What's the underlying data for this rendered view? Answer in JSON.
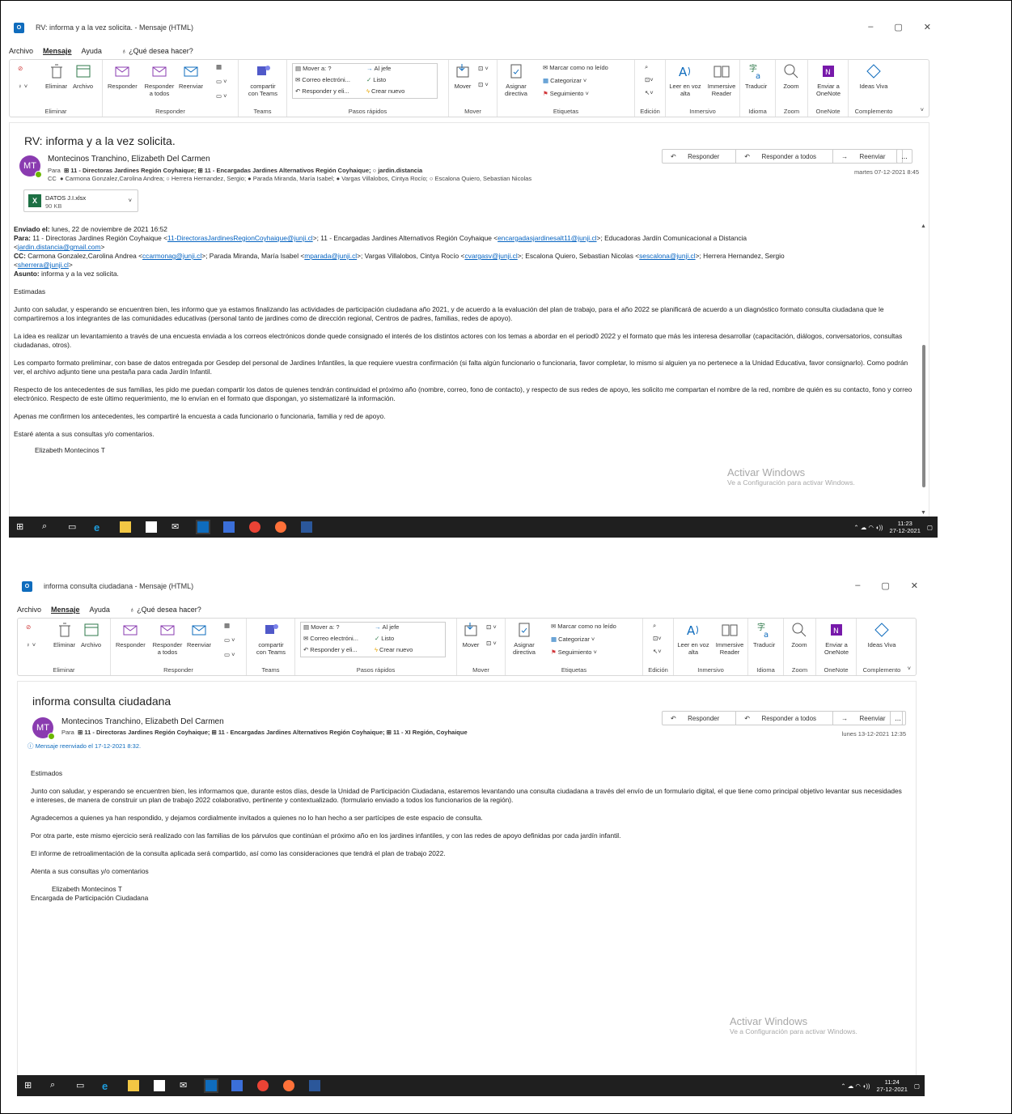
{
  "ribbon": {
    "menu": [
      "Archivo",
      "Mensaje",
      "Ayuda"
    ],
    "tell_me": "¿Qué desea hacer?",
    "eliminar": "Eliminar",
    "archivo": "Archivo",
    "group_eliminar": "Eliminar",
    "responder": "Responder",
    "responder_todos": "Responder a todos",
    "reenviar": "Reenviar",
    "group_responder": "Responder",
    "compartir_teams": "compartir con Teams",
    "group_teams": "Teams",
    "qs_mover": "Mover a: ?",
    "qs_correo": "Correo electróni...",
    "qs_responder": "Responder y eli...",
    "qs_jefe": "Al jefe",
    "qs_listo": "Listo",
    "qs_crear": "Crear nuevo",
    "group_pasos": "Pasos rápidos",
    "mover": "Mover",
    "group_mover": "Mover",
    "asignar": "Asignar directiva",
    "marcar": "Marcar como no leído",
    "categorizar": "Categorizar",
    "seguimiento": "Seguimiento",
    "group_etiquetas": "Etiquetas",
    "group_edicion": "Edición",
    "leer": "Leer en voz alta",
    "immersive": "Immersive Reader",
    "group_inmersivo": "Inmersivo",
    "traducir": "Traducir",
    "group_idioma": "Idioma",
    "zoom": "Zoom",
    "group_zoom": "Zoom",
    "onenote": "Enviar a OneNote",
    "group_onenote": "OneNote",
    "ideas": "Ideas Viva",
    "group_complemento": "Complemento"
  },
  "reply_actions": {
    "responder": "Responder",
    "responder_todos": "Responder a todos",
    "reenviar": "Reenviar",
    "more": "..."
  },
  "avatar_initials": "MT",
  "sender": "Montecinos Tranchino, Elizabeth Del Carmen",
  "para_label": "Para",
  "cc_label": "CC",
  "watermark": {
    "title": "Activar Windows",
    "subtitle": "Ve a Configuración para activar Windows."
  },
  "window1": {
    "title": "RV: informa y a la vez solicita.  -  Mensaje (HTML)",
    "subject": "RV: informa y a la vez solicita.",
    "to_line": "⊞ 11 - Directoras Jardines Región Coyhaique;  ⊞ 11 - Encargadas Jardines Alternativos Región Coyhaique;  ○ jardin.distancia",
    "cc_line": "● Carmona Gonzalez,Carolina Andrea;  ○ Herrera Hernandez, Sergio;  ● Parada Miranda, María Isabel;  ● Vargas Villalobos, Cintya Rocío;  ○ Escalona Quiero, Sebastian Nicolas",
    "date": "martes 07-12-2021 8:45",
    "attachment_name": "DATOS J.I.xlsx",
    "attachment_size": "90 KB",
    "enviado_label": "Enviado el:",
    "enviado_value": " lunes, 22 de noviembre de 2021 16:52",
    "para_label": "Para:",
    "para_1": " 11 - Directoras Jardines Región Coyhaique <",
    "para_link1": "11-DirectorasJardinesRegionCoyhaique@junji.cl",
    "para_2": ">; 11 - Encargadas Jardines Alternativos Región Coyhaique <",
    "para_link2": "encargadasjardinesalt11@junji.cl",
    "para_3": ">; Educadoras Jardín Comunicacional a Distancia",
    "para_4": "<",
    "para_link3": "jardin.distancia@gmail.com",
    "para_5": ">",
    "cc_label": "CC:",
    "cc_1": " Carmona Gonzalez,Carolina Andrea <",
    "cc_link1": "ccarmonag@junji.cl",
    "cc_2": ">; Parada Miranda, María Isabel <",
    "cc_link2": "mparada@junji.cl",
    "cc_3": ">; Vargas Villalobos, Cintya Rocío <",
    "cc_link3": "cvargasv@junji.cl",
    "cc_4": ">; Escalona Quiero, Sebastian Nicolas <",
    "cc_link4": "sescalona@junji.cl",
    "cc_5": ">; Herrera Hernandez, Sergio",
    "cc_6": "<",
    "cc_link5": "sherrera@junji.cl",
    "cc_7": ">",
    "asunto_label": "Asunto:",
    "asunto_value": " informa y a la vez solicita.",
    "p_greeting": "Estimadas",
    "p1": "Junto con saludar, y esperando se encuentren bien, les informo que ya estamos finalizando las actividades de participación ciudadana año 2021, y de acuerdo a la evaluación del plan de trabajo, para el año 2022 se planificará de acuerdo a un diagnóstico formato consulta ciudadana que le compartiremos a los integrantes de las comunidades educativas (personal tanto de jardines como de dirección regional, Centros de padres, familias, redes de apoyo).",
    "p2": "La idea es realizar un levantamiento a través de una encuesta enviada a los correos electrónicos donde quede consignado el interés de los distintos actores con los temas a abordar en el period0 2022 y el formato que más les interesa desarrollar (capacitación, diálogos, conversatorios, consultas ciudadanas, otros).",
    "p3": "Les comparto formato preliminar, con base de datos entregada por Gesdep del personal de Jardines Infantiles, la que requiere vuestra confirmación (si falta algún funcionario o funcionaria, favor completar, lo mismo si alguien ya no pertenece a la Unidad Educativa, favor consignarlo). Como podrán ver, el archivo adjunto tiene una pestaña para cada Jardín Infantil.",
    "p4": "Respecto de los antecedentes de sus familias, les pido me puedan compartir los datos de quienes tendrán continuidad el próximo año (nombre, correo, fono de contacto), y respecto de sus redes de apoyo, les solicito me compartan el nombre de la red, nombre de quién es su contacto, fono y correo electrónico. Respecto de este último requerimiento, me lo envían en el formato que dispongan, yo sistematizaré la información.",
    "p5": "Apenas me confirmen los antecedentes, les compartiré la encuesta a cada funcionario o funcionaria, familia y red de apoyo.",
    "p6": "Estaré atenta a sus consultas y/o comentarios.",
    "signature": "Elizabeth Montecinos T",
    "clock_time": "11:23",
    "clock_date": "27-12-2021"
  },
  "window2": {
    "title": "informa consulta ciudadana  -  Mensaje (HTML)",
    "subject": "informa consulta ciudadana",
    "to_line": "⊞ 11 - Directoras Jardines Región Coyhaique;  ⊞ 11 - Encargadas Jardines Alternativos Región Coyhaique;  ⊞ 11 - XI Región, Coyhaique",
    "forwarded": "Mensaje reenviado el 17-12-2021 8:32.",
    "date": "lunes 13-12-2021 12:35",
    "p_greeting": "Estimados",
    "p1": "Junto con saludar, y esperando se encuentren bien, les informamos que, durante estos días, desde la Unidad de Participación Ciudadana, estaremos levantando una consulta ciudadana a través del envío de un formulario digital, el que tiene como principal objetivo levantar sus necesidades e intereses, de manera de construir un plan de trabajo 2022 colaborativo, pertinente y contextualizado. (formulario enviado a todos los funcionarios de la región).",
    "p2": "Agradecemos a quienes ya han respondido, y dejamos cordialmente invitados a quienes no lo han hecho a ser partícipes de este espacio de consulta.",
    "p3": "Por otra parte, este mismo ejercicio será realizado con las familias de los párvulos que continúan el próximo año en los jardines infantiles, y con las redes de apoyo definidas por cada jardín infantil.",
    "p4": "El informe de retroalimentación de la consulta aplicada será compartido, así como las consideraciones que tendrá el plan de trabajo 2022.",
    "p5": "Atenta a sus consultas y/o comentarios",
    "signature": "Elizabeth Montecinos T",
    "signature_role": "Encargada de Participación Ciudadana",
    "clock_time": "11:24",
    "clock_date": "27-12-2021"
  }
}
